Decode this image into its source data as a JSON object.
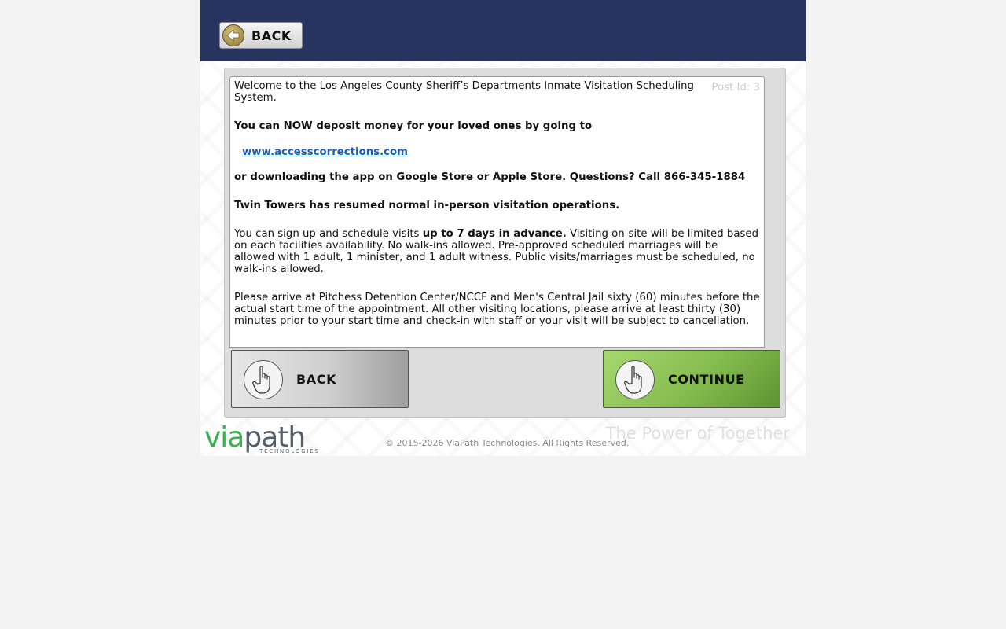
{
  "header": {
    "back_label": "BACK"
  },
  "message": {
    "post_id": "Post Id: 3",
    "intro": "Welcome to the Los Angeles County Sheriff’s Departments Inmate Visitation Scheduling System.",
    "deposit_line": "You can NOW deposit money for your loved ones by going to",
    "link_text": "www.accesscorrections.com",
    "download_line": "or downloading the app on Google Store or Apple Store. Questions? Call 866-345-1884",
    "twin_towers": "Twin Towers has resumed normal in-person visitation operations.",
    "signup_prefix": "You can sign up and schedule visits ",
    "signup_bold": "up to 7 days in advance.",
    "signup_suffix": " Visiting on-site will be limited based on each facilities availability. No walk-ins allowed. Pre-approved scheduled marriages will be allowed with 1 adult, 1 minister, and 1 adult witness. Public visits/marriages must be scheduled, no walk-ins allowed.",
    "arrival": "Please arrive at Pitchess Detention Center/NCCF and Men's Central Jail sixty (60) minutes before the actual start time of the appointment. All other visiting locations, please arrive at least thirty (30) minutes prior to your start time and check-in with staff or your visit will be subject to cancellation."
  },
  "buttons": {
    "back_label": "BACK",
    "continue_label": "CONTINUE"
  },
  "footer": {
    "logo_via": "via",
    "logo_path": "path",
    "logo_sub": "TECHNOLOGIES",
    "copyright": "© 2015-2026 ViaPath Technologies. All Rights Reserved.",
    "tagline": "The Power of Together"
  },
  "colors": {
    "header_bg": "#27345f",
    "continue_green": "#84bb4e",
    "link_blue": "#1a5eb8",
    "logo_green": "#37b24d"
  },
  "icons": {
    "top_back": "back-arrow-icon",
    "button_hand": "pointing-hand-icon"
  }
}
